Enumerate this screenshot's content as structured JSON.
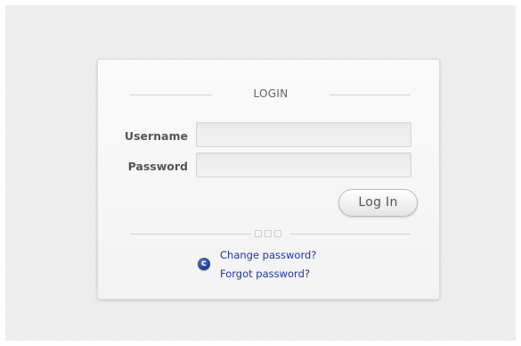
{
  "login": {
    "title": "LOGIN",
    "username_label": "Username",
    "password_label": "Password",
    "username_value": "",
    "password_value": "",
    "submit_label": "Log In",
    "links": {
      "change_password": "Change password?",
      "forgot_password": "Forgot password?"
    },
    "help_icon": "blue-circle-c-icon"
  },
  "colors": {
    "link": "#1f34a6",
    "icon": "#1d3a8a",
    "label": "#555555"
  }
}
